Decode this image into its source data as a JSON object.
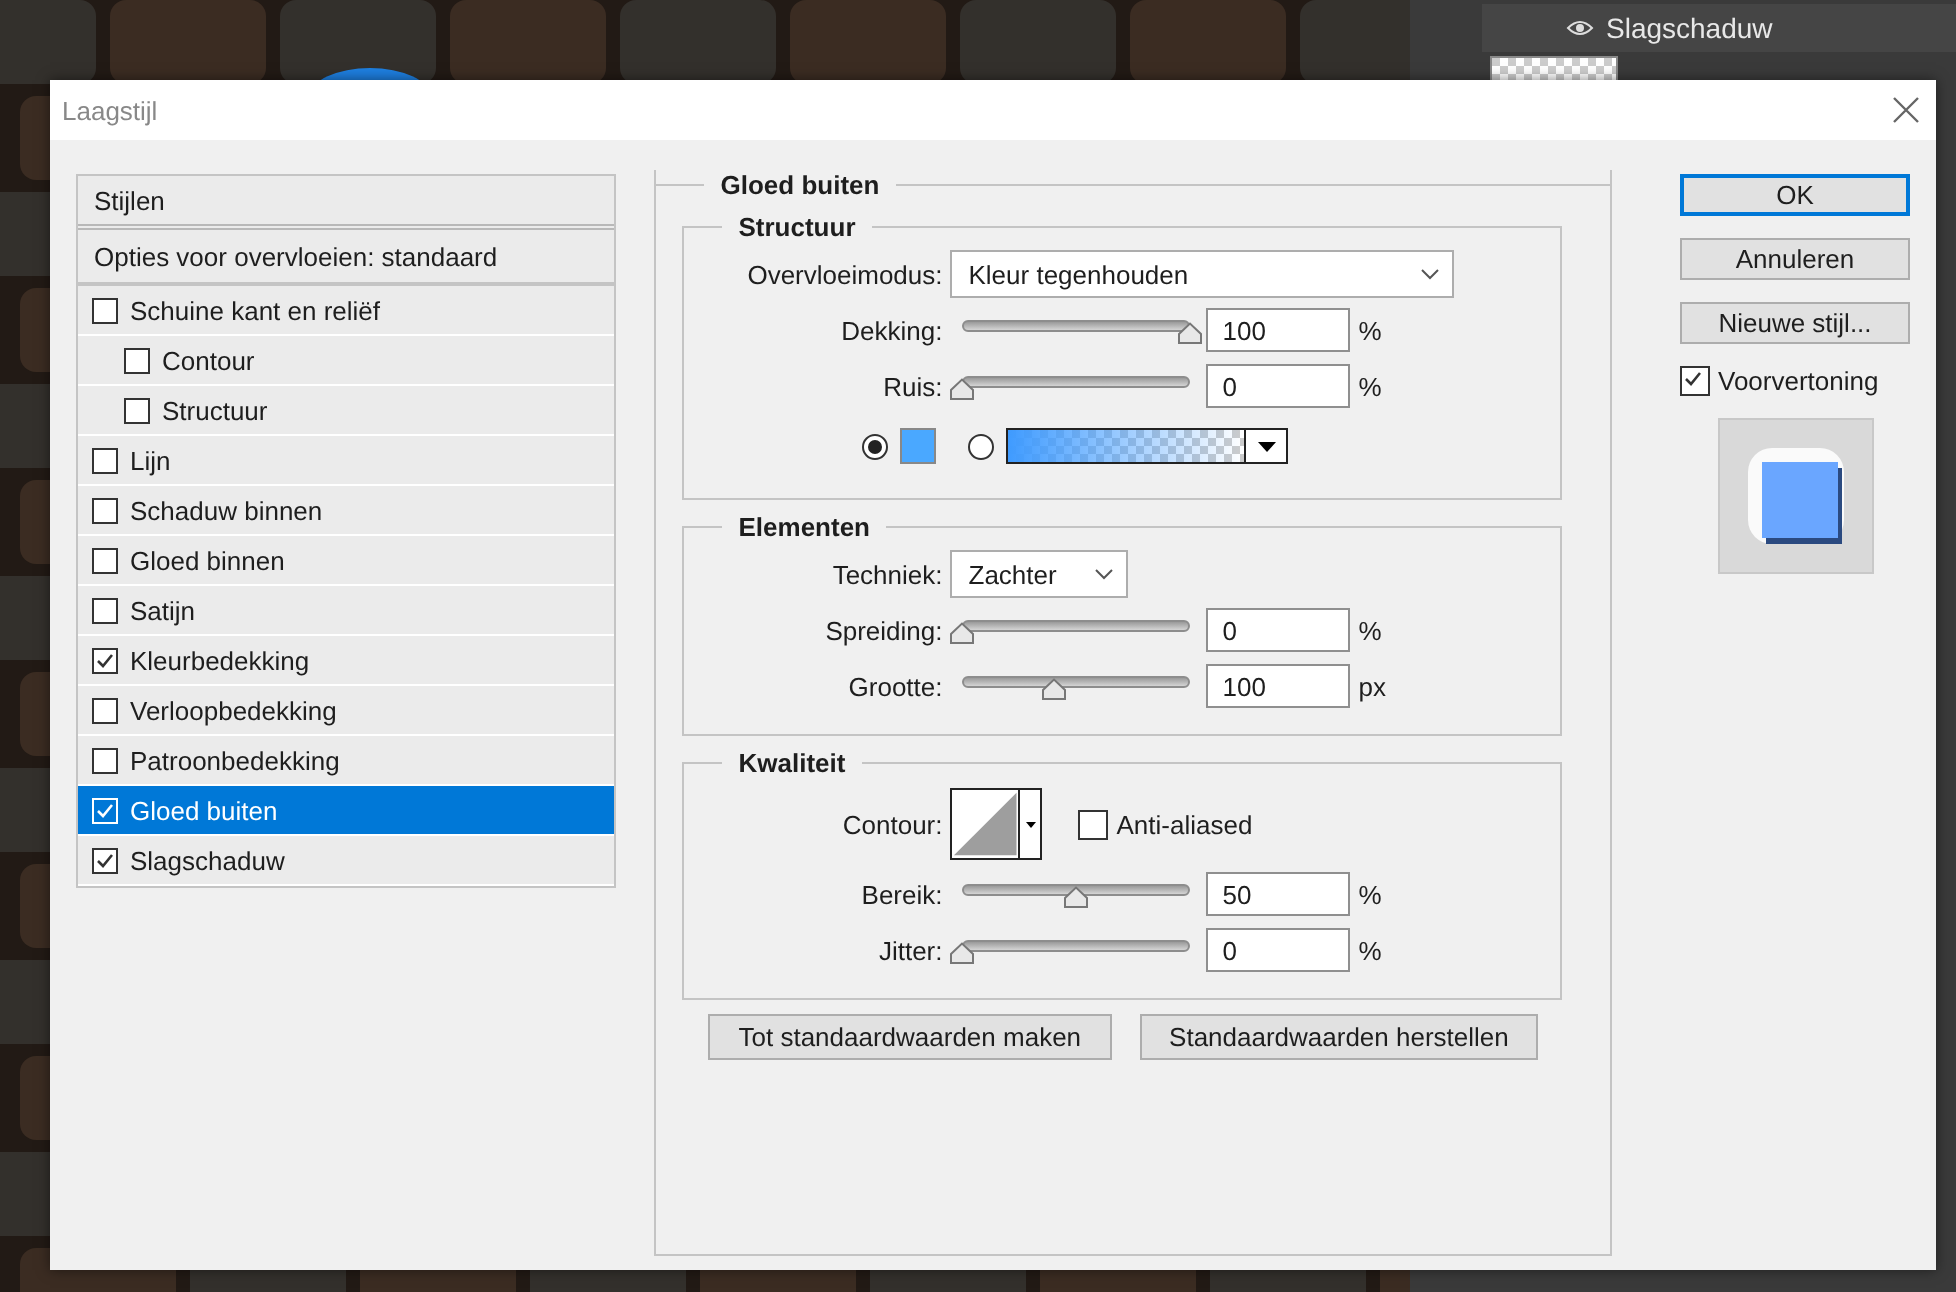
{
  "layers_panel": {
    "effect_name": "Slagschaduw"
  },
  "dialog": {
    "title": "Laagstijl",
    "styles_list": {
      "header": "Stijlen",
      "blend_options": "Opties voor overvloeien: standaard",
      "items": [
        {
          "label": "Schuine kant en reliëf",
          "checked": false,
          "selected": false,
          "children": [
            {
              "label": "Contour",
              "checked": false,
              "selected": false
            },
            {
              "label": "Structuur",
              "checked": false,
              "selected": false
            }
          ]
        },
        {
          "label": "Lijn",
          "checked": false,
          "selected": false
        },
        {
          "label": "Schaduw binnen",
          "checked": false,
          "selected": false
        },
        {
          "label": "Gloed binnen",
          "checked": false,
          "selected": false
        },
        {
          "label": "Satijn",
          "checked": false,
          "selected": false
        },
        {
          "label": "Kleurbedekking",
          "checked": true,
          "selected": false
        },
        {
          "label": "Verloopbedekking",
          "checked": false,
          "selected": false
        },
        {
          "label": "Patroonbedekking",
          "checked": false,
          "selected": false
        },
        {
          "label": "Gloed buiten",
          "checked": true,
          "selected": true
        },
        {
          "label": "Slagschaduw",
          "checked": true,
          "selected": false
        }
      ]
    },
    "panel": {
      "title": "Gloed buiten",
      "sections": [
        {
          "title": "Structuur",
          "rows": [
            {
              "kind": "select",
              "label": "Overvloeimodus:",
              "value": "Kleur tegenhouden"
            },
            {
              "kind": "slider",
              "label": "Dekking:",
              "level": 1,
              "value": "100",
              "unit": "%"
            },
            {
              "kind": "slider",
              "label": "Ruis:",
              "level": 0,
              "value": "0",
              "unit": "%"
            },
            {
              "kind": "fill",
              "options": [
                {
                  "kind": "color",
                  "selected": true
                },
                {
                  "kind": "gradient",
                  "selected": false
                }
              ]
            }
          ]
        },
        {
          "title": "Elementen",
          "rows": [
            {
              "kind": "select",
              "label": "Techniek:",
              "value": "Zachter"
            },
            {
              "kind": "slider",
              "label": "Spreiding:",
              "level": 0,
              "value": "0",
              "unit": "%"
            },
            {
              "kind": "slider",
              "label": "Grootte:",
              "level": 0.4,
              "value": "100",
              "unit": "px"
            }
          ]
        },
        {
          "title": "Kwaliteit",
          "rows": [
            {
              "kind": "contour",
              "label": "Contour:",
              "checkbox_label": "Anti-aliased",
              "checked": false
            },
            {
              "kind": "slider",
              "label": "Bereik:",
              "level": 0.5,
              "value": "50",
              "unit": "%"
            },
            {
              "kind": "slider",
              "label": "Jitter:",
              "level": 0,
              "value": "0",
              "unit": "%"
            }
          ]
        }
      ],
      "buttons": [
        "Tot standaardwaarden maken",
        "Standaardwaarden herstellen"
      ]
    },
    "actions": [
      {
        "label": "OK",
        "default": true
      },
      {
        "label": "Annuleren",
        "default": false
      },
      {
        "label": "Nieuwe stijl...",
        "default": false
      }
    ],
    "preview": {
      "label": "Voorvertoning",
      "checked": true
    }
  }
}
